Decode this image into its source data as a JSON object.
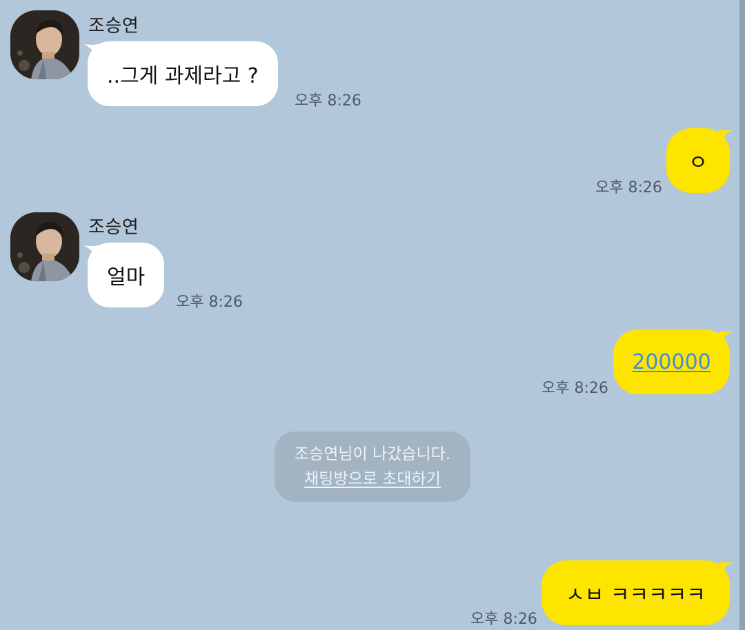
{
  "messages": [
    {
      "sender": "조승연",
      "text": "..그게 과제라고 ?",
      "time": "오후 8:26"
    },
    {
      "text": "ㅇ",
      "time": "오후 8:26"
    },
    {
      "sender": "조승연",
      "text": "얼마",
      "time": "오후 8:26"
    },
    {
      "text": "200000",
      "time": "오후 8:26"
    },
    {
      "text": "ㅅㅂ ㅋㅋㅋㅋㅋ",
      "time": "오후 8:26"
    }
  ],
  "system_notice": {
    "left_text": "조승연님이 나갔습니다.",
    "invite_link": "채팅방으로 초대하기"
  },
  "colors": {
    "background": "#b2c7da",
    "my_bubble": "#fee500",
    "their_bubble": "#ffffff",
    "link": "#3e8fd6"
  },
  "icons": {
    "avatar": "profile-photo"
  }
}
